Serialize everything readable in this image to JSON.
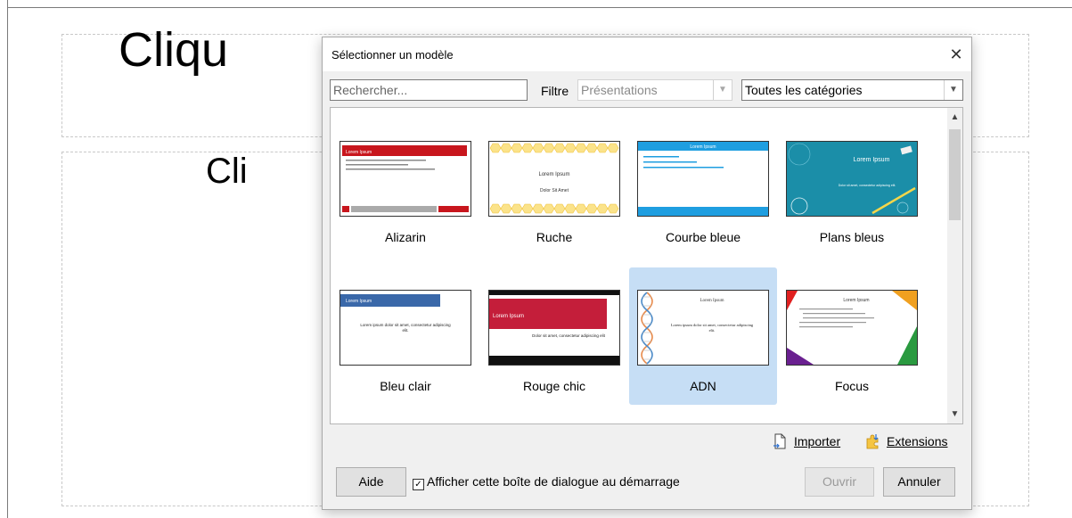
{
  "background": {
    "title_placeholder": "Cliqu",
    "content_placeholder": "Cli"
  },
  "dialog": {
    "title": "Sélectionner un modèle",
    "close_icon": "close-icon",
    "search": {
      "placeholder": "Rechercher..."
    },
    "filter": {
      "label": "Filtre",
      "type_value": "Présentations",
      "category_value": "Toutes les catégories"
    },
    "templates": [
      {
        "name": "Alizarin",
        "selected": false
      },
      {
        "name": "Ruche",
        "selected": false
      },
      {
        "name": "Courbe bleue",
        "selected": false
      },
      {
        "name": "Plans bleus",
        "selected": false
      },
      {
        "name": "Bleu clair",
        "selected": false
      },
      {
        "name": "Rouge chic",
        "selected": false
      },
      {
        "name": "ADN",
        "selected": true
      },
      {
        "name": "Focus",
        "selected": false
      }
    ],
    "thumbs": {
      "alizarin_title": "Lorem Ipsum",
      "ruche_title": "Lorem Ipsum",
      "ruche_sub": "Dolor Sit Amet",
      "courbe_title": "Lorem Ipsum",
      "plans_title": "Lorem Ipsum",
      "plans_sub": "Dolor sit amet, consectetur adipiscing elit.",
      "bleu_title": "Lorem Ipsum",
      "bleu_body": "Lorem ipsum dolor sit amet, consectetur adipiscing elit.",
      "rouge_title": "Lorem Ipsum",
      "rouge_body": "Dolor sit amet, consectetur adipiscing elit",
      "adn_title": "Lorem Ipsum",
      "adn_body": "Lorem ipsum dolor sit amet, consectetur adipiscing elit.",
      "focus_title": "Lorem Ipsum"
    },
    "actions": {
      "import_label": "Importer",
      "extensions_label": "Extensions"
    },
    "footer": {
      "help_label": "Aide",
      "checkbox_label": "Afficher cette boîte de dialogue au démarrage",
      "checkbox_checked": true,
      "open_label": "Ouvrir",
      "cancel_label": "Annuler"
    }
  }
}
